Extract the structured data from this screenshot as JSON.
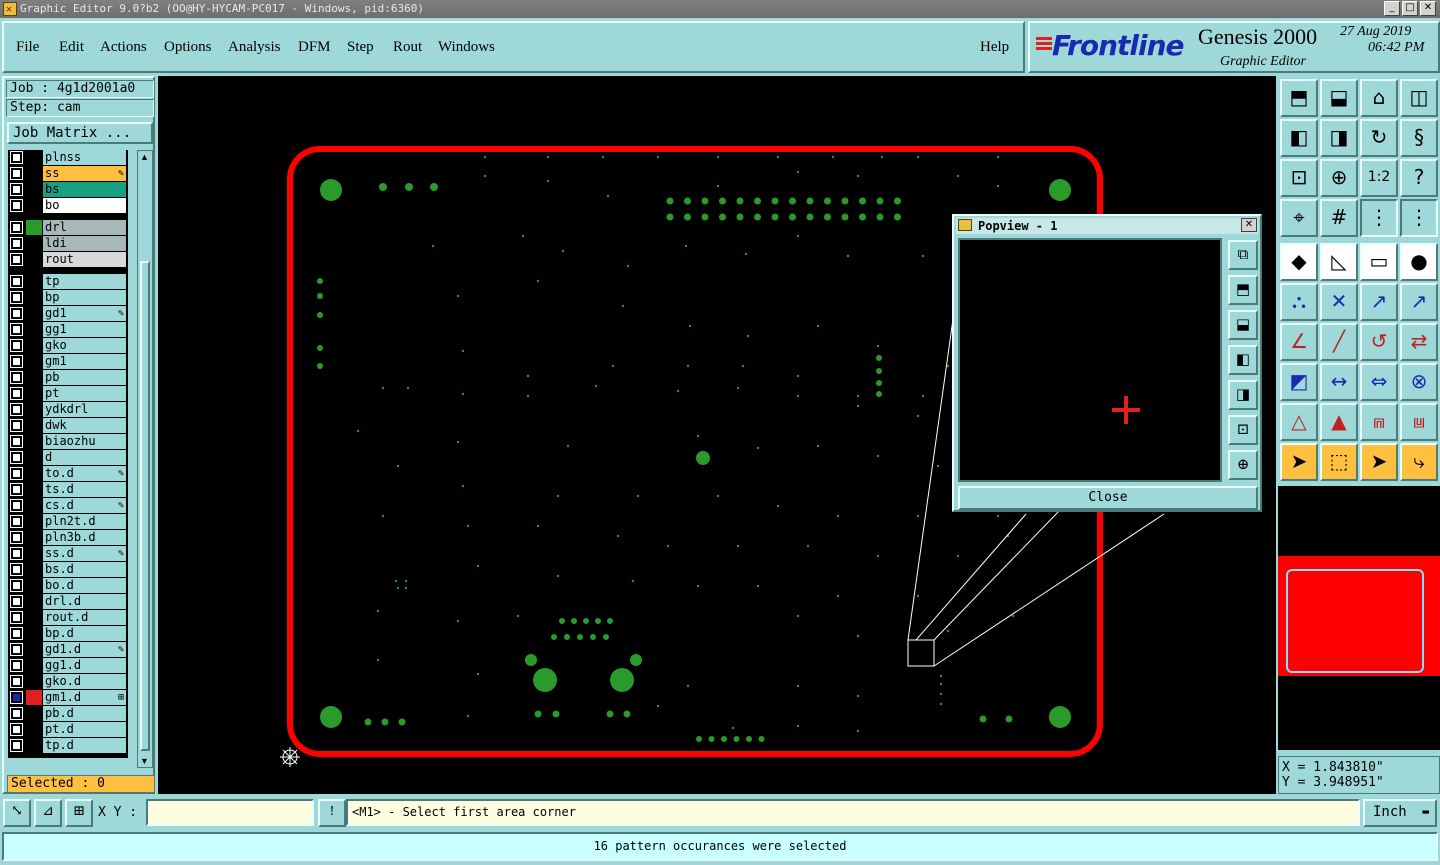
{
  "window": {
    "title": "Graphic Editor 9.0?b2 (OO@HY-HYCAM-PC017 - Windows, pid:6360)",
    "controls": [
      "_",
      "□",
      "✕"
    ]
  },
  "menu": {
    "file": "File",
    "edit": "Edit",
    "actions": "Actions",
    "options": "Options",
    "analysis": "Analysis",
    "dfm": "DFM",
    "step": "Step",
    "rout": "Rout",
    "windows": "Windows",
    "help": "Help"
  },
  "brand": {
    "logo": "Frontline",
    "product": "Genesis 2000",
    "subtitle": "Graphic Editor",
    "date": "27 Aug 2019",
    "time": "06:42 PM"
  },
  "job": {
    "job_label": "Job : 4g1d2001a0",
    "step_label": "Step: cam",
    "matrix_button": "Job Matrix ...",
    "selected": "Selected : 0"
  },
  "layers": [
    {
      "name": "plnss",
      "color": "#9fd8d8",
      "swatch": "#9fd8d8",
      "mark": ""
    },
    {
      "name": "ss",
      "color": "#ffc040",
      "swatch": "#9fd8d8",
      "mark": "✎"
    },
    {
      "name": "bs",
      "color": "#16a080",
      "swatch": "#9fd8d8",
      "mark": ""
    },
    {
      "name": "bo",
      "color": "#ffffff",
      "swatch": "#9fd8d8",
      "mark": ""
    },
    {
      "name": "drl",
      "color": "#a8b8b8",
      "swatch": "#2a9a2a",
      "mark": ""
    },
    {
      "name": "ldi",
      "color": "#a8b8b8",
      "swatch": "#9fd8d8",
      "mark": ""
    },
    {
      "name": "rout",
      "color": "#d8d8d8",
      "swatch": "#9fd8d8",
      "mark": ""
    },
    {
      "name": "tp",
      "color": "#9fd8d8",
      "swatch": "#9fd8d8",
      "mark": ""
    },
    {
      "name": "bp",
      "color": "#9fd8d8",
      "swatch": "#9fd8d8",
      "mark": ""
    },
    {
      "name": "gd1",
      "color": "#9fd8d8",
      "swatch": "#9fd8d8",
      "mark": "✎"
    },
    {
      "name": "gg1",
      "color": "#9fd8d8",
      "swatch": "#9fd8d8",
      "mark": ""
    },
    {
      "name": "gko",
      "color": "#9fd8d8",
      "swatch": "#9fd8d8",
      "mark": ""
    },
    {
      "name": "gm1",
      "color": "#9fd8d8",
      "swatch": "#9fd8d8",
      "mark": ""
    },
    {
      "name": "pb",
      "color": "#9fd8d8",
      "swatch": "#9fd8d8",
      "mark": ""
    },
    {
      "name": "pt",
      "color": "#9fd8d8",
      "swatch": "#9fd8d8",
      "mark": ""
    },
    {
      "name": "ydkdrl",
      "color": "#9fd8d8",
      "swatch": "#9fd8d8",
      "mark": ""
    },
    {
      "name": "dwk",
      "color": "#9fd8d8",
      "swatch": "#9fd8d8",
      "mark": ""
    },
    {
      "name": "biaozhu",
      "color": "#9fd8d8",
      "swatch": "#9fd8d8",
      "mark": ""
    },
    {
      "name": "d",
      "color": "#9fd8d8",
      "swatch": "#9fd8d8",
      "mark": ""
    },
    {
      "name": "to.d",
      "color": "#9fd8d8",
      "swatch": "#9fd8d8",
      "mark": "✎"
    },
    {
      "name": "ts.d",
      "color": "#9fd8d8",
      "swatch": "#9fd8d8",
      "mark": ""
    },
    {
      "name": "cs.d",
      "color": "#9fd8d8",
      "swatch": "#9fd8d8",
      "mark": "✎"
    },
    {
      "name": "pln2t.d",
      "color": "#9fd8d8",
      "swatch": "#9fd8d8",
      "mark": ""
    },
    {
      "name": "pln3b.d",
      "color": "#9fd8d8",
      "swatch": "#9fd8d8",
      "mark": ""
    },
    {
      "name": "ss.d",
      "color": "#9fd8d8",
      "swatch": "#9fd8d8",
      "mark": "✎"
    },
    {
      "name": "bs.d",
      "color": "#9fd8d8",
      "swatch": "#9fd8d8",
      "mark": ""
    },
    {
      "name": "bo.d",
      "color": "#9fd8d8",
      "swatch": "#9fd8d8",
      "mark": ""
    },
    {
      "name": "drl.d",
      "color": "#9fd8d8",
      "swatch": "#9fd8d8",
      "mark": ""
    },
    {
      "name": "rout.d",
      "color": "#9fd8d8",
      "swatch": "#9fd8d8",
      "mark": ""
    },
    {
      "name": "bp.d",
      "color": "#9fd8d8",
      "swatch": "#9fd8d8",
      "mark": ""
    },
    {
      "name": "gd1.d",
      "color": "#9fd8d8",
      "swatch": "#9fd8d8",
      "mark": "✎"
    },
    {
      "name": "gg1.d",
      "color": "#9fd8d8",
      "swatch": "#9fd8d8",
      "mark": ""
    },
    {
      "name": "gko.d",
      "color": "#9fd8d8",
      "swatch": "#9fd8d8",
      "mark": ""
    },
    {
      "name": "gm1.d",
      "color": "#9fd8d8",
      "swatch": "#e02020",
      "mark": "⊞",
      "active": true
    },
    {
      "name": "pb.d",
      "color": "#9fd8d8",
      "swatch": "#9fd8d8",
      "mark": ""
    },
    {
      "name": "pt.d",
      "color": "#9fd8d8",
      "swatch": "#9fd8d8",
      "mark": ""
    },
    {
      "name": "tp.d",
      "color": "#9fd8d8",
      "swatch": "#9fd8d8",
      "mark": ""
    }
  ],
  "popview": {
    "title": "Popview - 1",
    "close_label": "Close",
    "tools": [
      "zoom-fit-icon",
      "zoom-home-icon",
      "zoom-step-icon",
      "pan-left-icon",
      "pan-right-icon",
      "fit-all-icon",
      "center-icon"
    ]
  },
  "toolbar": {
    "rows": [
      [
        "zoom-in-icon",
        "zoom-out-icon",
        "home-icon",
        "window-split-icon"
      ],
      [
        "pan-left-icon",
        "pan-right-icon",
        "rotate-icon",
        "redraw-icon"
      ],
      [
        "fit-icon",
        "center-icon",
        "ratio-icon",
        "help-icon"
      ],
      [
        "snap-icon",
        "grid-icon",
        "layers-icon",
        "layers-alt-icon"
      ],
      [
        "select-icon",
        "measure-icon",
        "ruler-icon",
        "pad-icon"
      ],
      [
        "connect-icon",
        "cross-icon",
        "move-icon",
        "copy-icon"
      ],
      [
        "angle-icon",
        "line-icon",
        "arc-icon",
        "mirror-icon"
      ],
      [
        "pad-move-icon",
        "split-icon",
        "dimension-icon",
        "group-icon"
      ],
      [
        "triangle-icon",
        "triangle-alt-icon",
        "arch-icon",
        "arch-alt-icon"
      ],
      [
        "pointer-icon",
        "pointer-box-icon",
        "pointer-select-icon",
        "route-icon"
      ]
    ],
    "ratio_label": "1:2"
  },
  "coords": {
    "x": "X = 1.843810\"",
    "y": "Y = 3.948951\""
  },
  "command": {
    "xy_label": "X Y :",
    "xy_value": "",
    "prompt": "<M1> - Select first area corner",
    "units": "Inch"
  },
  "status": {
    "message": "16 pattern occurances were selected"
  },
  "colors": {
    "panel": "#9fd8d8",
    "board_outline": "#ff0000",
    "pad": "#2a9a2a",
    "canvas": "#000000"
  }
}
